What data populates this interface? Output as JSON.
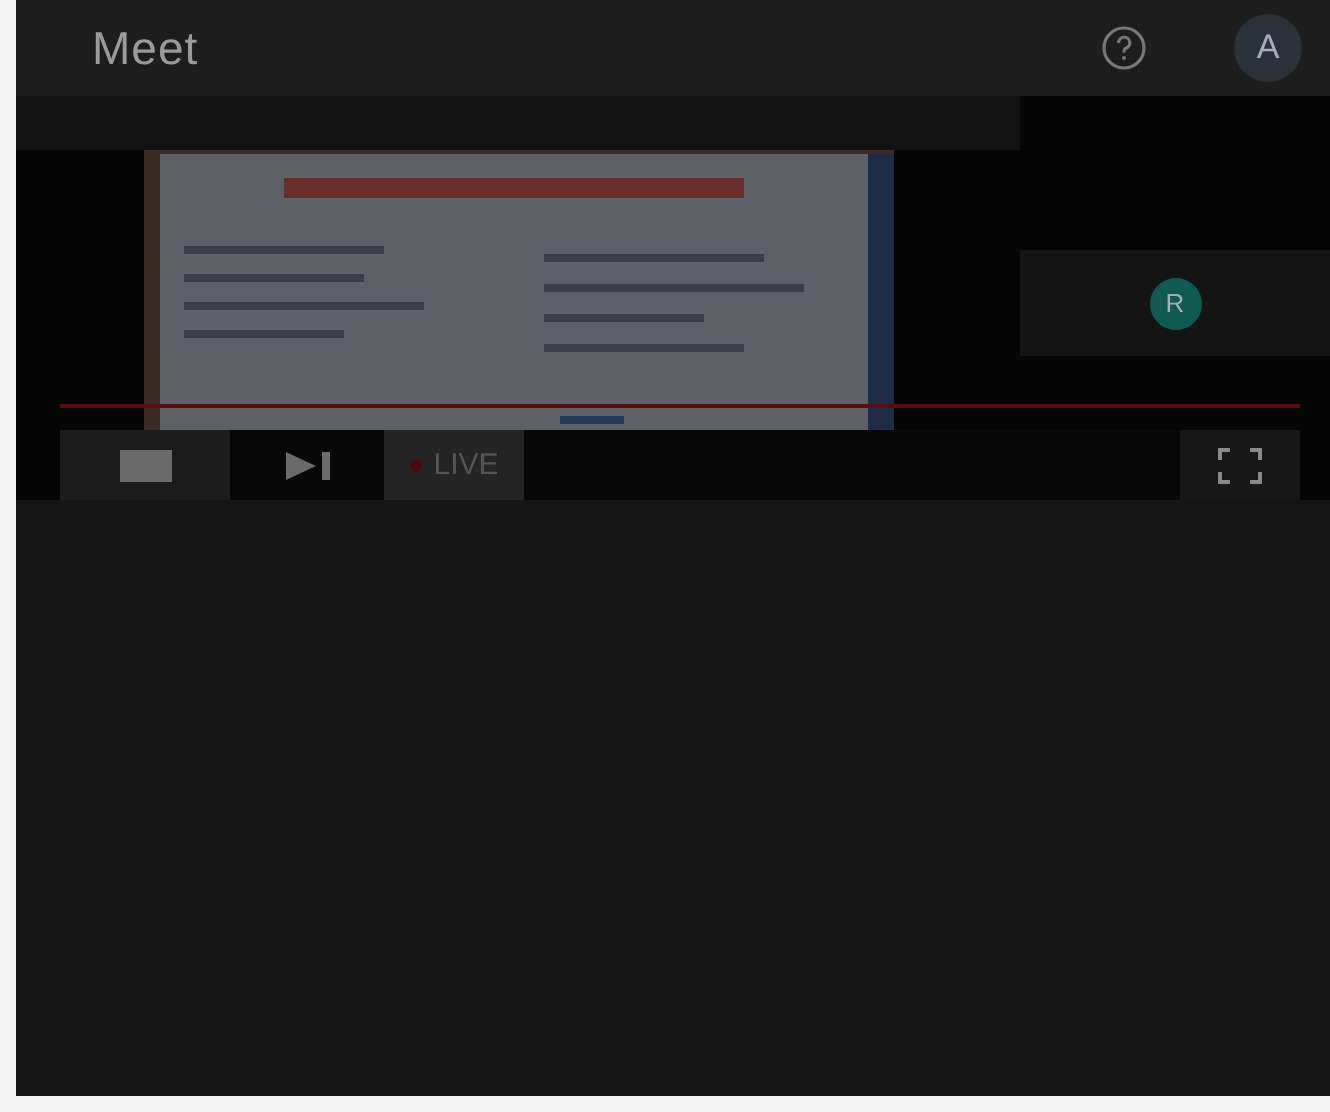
{
  "header": {
    "title": "Meet",
    "account_initial": "A"
  },
  "stream": {
    "progress": {
      "level": 1
    },
    "live_label": "LIVE"
  },
  "participants": [
    {
      "initial": "R"
    }
  ]
}
